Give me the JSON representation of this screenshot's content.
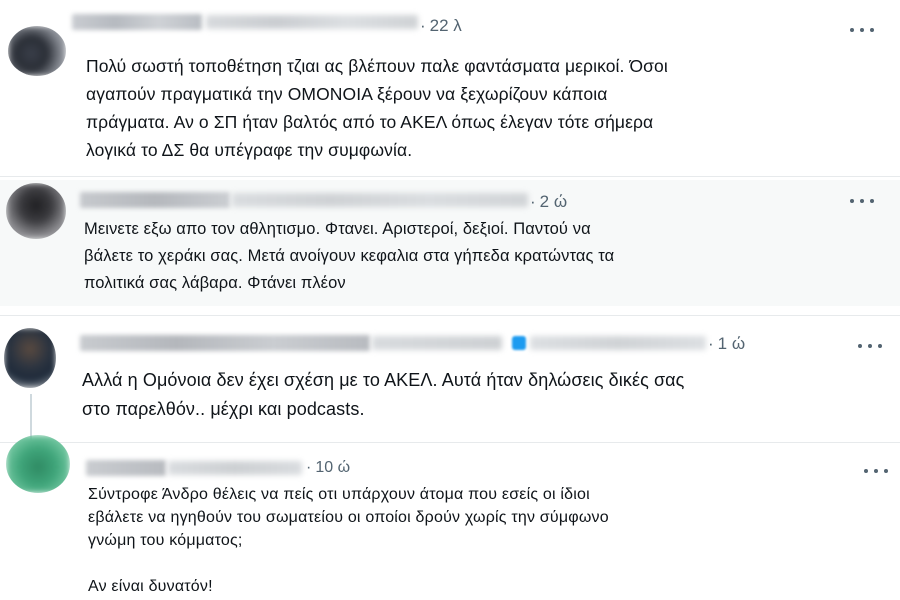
{
  "replies": [
    {
      "time": "22 λ",
      "text": "Πολύ σωστή τοποθέτηση τζιαι ας βλέπουν παλε φαντάσματα μερικοί. Όσοι\nαγαπούν πραγματικά την ΟΜΟΝΟΙΑ ξέρουν να ξεχωρίζουν κάποια\nπράγματα. Αν ο ΣΠ ήταν βαλτός από το ΑΚΕΛ όπως έλεγαν τότε σήμερα\nλογικά το ΔΣ θα υπέγραφε την συμφωνία."
    },
    {
      "time": "2 ώ",
      "text": "Μεινετε εξω απο τον αθλητισμο. Φτανει. Αριστεροί, δεξιοί. Παντού να\nβάλετε το χεράκι σας. Μετά ανοίγουν κεφαλια στα γήπεδα κρατώντας τα\nπολιτικά σας λάβαρα. Φτάνει πλέον"
    },
    {
      "time": "1 ώ",
      "text": "Αλλά η Ομόνοια δεν έχει σχέση με το ΑΚΕΛ. Αυτά ήταν δηλώσεις δικές σας\nστο παρελθόν.. μέχρι και podcasts."
    },
    {
      "time": "10 ώ",
      "text": "Σύντροφε Άνδρο θέλεις να πείς οτι υπάρχουν άτομα που εσείς οι ίδιοι\nεβάλετε να ηγηθούν του σωματείου οι οποίοι δρούν χωρίς την σύμφωνο\nγνώμη του κόμματος;\n\nΑν είναι δυνατόν!"
    }
  ],
  "icons": {
    "more": "more-options-icon"
  },
  "colors": {
    "text": "#0f1419",
    "muted": "#536471",
    "alt_background": "#f7f9f9",
    "verified": "#1d9bf0"
  }
}
